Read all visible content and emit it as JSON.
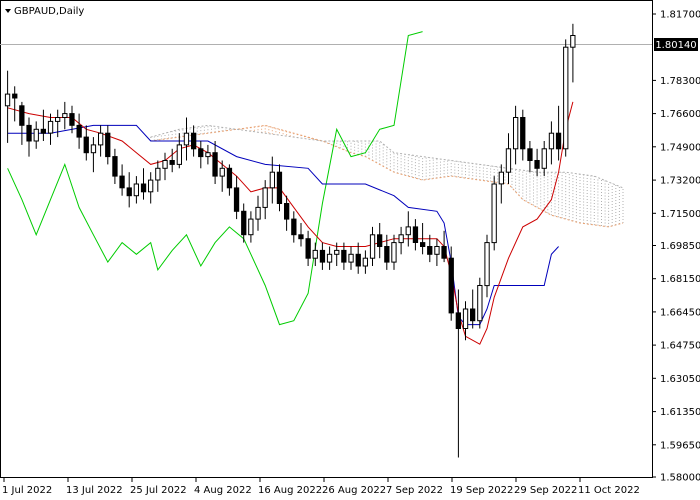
{
  "chart_title": "GBPAUD,Daily",
  "current_price_label": "1.80140",
  "colors": {
    "background": "#ffffff",
    "candle_stroke": "#000000",
    "bull_fill": "#ffffff",
    "bear_fill": "#000000",
    "tenkan": "#cc0000",
    "kijun": "#0000bb",
    "chikou": "#00cc00",
    "cloud": "#e8a070",
    "cloud_b": "#b0b0b0",
    "price_line": "#b0b0b0"
  },
  "chart_data": {
    "type": "candlestick",
    "title": "GBPAUD,Daily",
    "indicator": "Ichimoku",
    "ylim": [
      1.58,
      1.817
    ],
    "y_ticks": [
      "1.81700",
      "1.80140",
      "1.78300",
      "1.76600",
      "1.74900",
      "1.73200",
      "1.71500",
      "1.69850",
      "1.68150",
      "1.66450",
      "1.64750",
      "1.63050",
      "1.61350",
      "1.59650",
      "1.58000"
    ],
    "x_ticks": [
      "1 Jul 2022",
      "13 Jul 2022",
      "25 Jul 2022",
      "4 Aug 2022",
      "16 Aug 2022",
      "26 Aug 2022",
      "7 Sep 2022",
      "19 Sep 2022",
      "29 Sep 2022",
      "11 Oct 2022"
    ],
    "candles": [
      [
        1.77,
        1.788,
        1.751,
        1.776
      ],
      [
        1.776,
        1.78,
        1.762,
        1.774
      ],
      [
        1.77,
        1.772,
        1.75,
        1.76
      ],
      [
        1.76,
        1.764,
        1.744,
        1.752
      ],
      [
        1.752,
        1.762,
        1.748,
        1.758
      ],
      [
        1.758,
        1.768,
        1.752,
        1.756
      ],
      [
        1.756,
        1.766,
        1.75,
        1.762
      ],
      [
        1.762,
        1.768,
        1.754,
        1.764
      ],
      [
        1.764,
        1.772,
        1.758,
        1.766
      ],
      [
        1.766,
        1.77,
        1.756,
        1.76
      ],
      [
        1.76,
        1.766,
        1.748,
        1.754
      ],
      [
        1.754,
        1.76,
        1.742,
        1.746
      ],
      [
        1.746,
        1.754,
        1.736,
        1.75
      ],
      [
        1.75,
        1.76,
        1.744,
        1.756
      ],
      [
        1.756,
        1.76,
        1.74,
        1.744
      ],
      [
        1.744,
        1.748,
        1.73,
        1.734
      ],
      [
        1.734,
        1.74,
        1.724,
        1.728
      ],
      [
        1.728,
        1.736,
        1.718,
        1.724
      ],
      [
        1.724,
        1.734,
        1.72,
        1.73
      ],
      [
        1.73,
        1.738,
        1.722,
        1.726
      ],
      [
        1.726,
        1.736,
        1.72,
        1.732
      ],
      [
        1.732,
        1.742,
        1.726,
        1.738
      ],
      [
        1.738,
        1.746,
        1.732,
        1.742
      ],
      [
        1.742,
        1.748,
        1.736,
        1.74
      ],
      [
        1.74,
        1.756,
        1.738,
        1.75
      ],
      [
        1.75,
        1.764,
        1.742,
        1.756
      ],
      [
        1.756,
        1.76,
        1.744,
        1.748
      ],
      [
        1.748,
        1.752,
        1.738,
        1.744
      ],
      [
        1.744,
        1.75,
        1.74,
        1.746
      ],
      [
        1.746,
        1.752,
        1.73,
        1.734
      ],
      [
        1.734,
        1.742,
        1.726,
        1.738
      ],
      [
        1.738,
        1.74,
        1.724,
        1.728
      ],
      [
        1.728,
        1.734,
        1.712,
        1.716
      ],
      [
        1.716,
        1.72,
        1.7,
        1.704
      ],
      [
        1.704,
        1.716,
        1.7,
        1.712
      ],
      [
        1.712,
        1.724,
        1.706,
        1.718
      ],
      [
        1.718,
        1.732,
        1.712,
        1.728
      ],
      [
        1.728,
        1.744,
        1.72,
        1.736
      ],
      [
        1.736,
        1.74,
        1.716,
        1.72
      ],
      [
        1.72,
        1.724,
        1.706,
        1.712
      ],
      [
        1.712,
        1.716,
        1.7,
        1.704
      ],
      [
        1.704,
        1.71,
        1.698,
        1.702
      ],
      [
        1.702,
        1.706,
        1.688,
        1.692
      ],
      [
        1.692,
        1.7,
        1.688,
        1.696
      ],
      [
        1.696,
        1.7,
        1.686,
        1.69
      ],
      [
        1.69,
        1.698,
        1.686,
        1.694
      ],
      [
        1.694,
        1.7,
        1.688,
        1.696
      ],
      [
        1.696,
        1.7,
        1.686,
        1.69
      ],
      [
        1.69,
        1.698,
        1.686,
        1.694
      ],
      [
        1.694,
        1.7,
        1.684,
        1.688
      ],
      [
        1.688,
        1.696,
        1.684,
        1.692
      ],
      [
        1.692,
        1.708,
        1.688,
        1.704
      ],
      [
        1.704,
        1.71,
        1.692,
        1.698
      ],
      [
        1.698,
        1.704,
        1.686,
        1.69
      ],
      [
        1.69,
        1.704,
        1.686,
        1.7
      ],
      [
        1.7,
        1.708,
        1.694,
        1.704
      ],
      [
        1.704,
        1.716,
        1.698,
        1.708
      ],
      [
        1.708,
        1.712,
        1.696,
        1.7
      ],
      [
        1.7,
        1.71,
        1.694,
        1.698
      ],
      [
        1.698,
        1.704,
        1.69,
        1.694
      ],
      [
        1.694,
        1.702,
        1.688,
        1.698
      ],
      [
        1.698,
        1.706,
        1.69,
        1.692
      ],
      [
        1.692,
        1.698,
        1.66,
        1.664
      ],
      [
        1.664,
        1.676,
        1.59,
        1.656
      ],
      [
        1.656,
        1.67,
        1.65,
        1.666
      ],
      [
        1.666,
        1.676,
        1.656,
        1.66
      ],
      [
        1.66,
        1.682,
        1.656,
        1.678
      ],
      [
        1.678,
        1.704,
        1.672,
        1.7
      ],
      [
        1.7,
        1.734,
        1.696,
        1.73
      ],
      [
        1.73,
        1.74,
        1.72,
        1.736
      ],
      [
        1.736,
        1.756,
        1.73,
        1.748
      ],
      [
        1.748,
        1.77,
        1.74,
        1.764
      ],
      [
        1.764,
        1.768,
        1.742,
        1.748
      ],
      [
        1.748,
        1.752,
        1.736,
        1.742
      ],
      [
        1.742,
        1.748,
        1.734,
        1.738
      ],
      [
        1.738,
        1.752,
        1.734,
        1.748
      ],
      [
        1.748,
        1.762,
        1.74,
        1.756
      ],
      [
        1.756,
        1.77,
        1.742,
        1.748
      ],
      [
        1.748,
        1.804,
        1.744,
        1.8
      ],
      [
        1.8,
        1.812,
        1.782,
        1.806
      ]
    ],
    "tenkan": [
      [
        0,
        1.769
      ],
      [
        3,
        1.766
      ],
      [
        6,
        1.764
      ],
      [
        9,
        1.764
      ],
      [
        11,
        1.758
      ],
      [
        13,
        1.756
      ],
      [
        16,
        1.752
      ],
      [
        18,
        1.746
      ],
      [
        20,
        1.74
      ],
      [
        22,
        1.742
      ],
      [
        24,
        1.748
      ],
      [
        26,
        1.75
      ],
      [
        28,
        1.746
      ],
      [
        30,
        1.74
      ],
      [
        32,
        1.734
      ],
      [
        34,
        1.726
      ],
      [
        36,
        1.728
      ],
      [
        38,
        1.728
      ],
      [
        40,
        1.718
      ],
      [
        42,
        1.708
      ],
      [
        44,
        1.7
      ],
      [
        46,
        1.698
      ],
      [
        48,
        1.698
      ],
      [
        50,
        1.698
      ],
      [
        52,
        1.7
      ],
      [
        54,
        1.702
      ],
      [
        56,
        1.702
      ],
      [
        58,
        1.702
      ],
      [
        60,
        1.702
      ],
      [
        61,
        1.698
      ],
      [
        62,
        1.684
      ],
      [
        63,
        1.664
      ],
      [
        64,
        1.652
      ],
      [
        66,
        1.648
      ],
      [
        67,
        1.656
      ],
      [
        68,
        1.672
      ],
      [
        70,
        1.692
      ],
      [
        72,
        1.708
      ],
      [
        74,
        1.712
      ],
      [
        76,
        1.722
      ],
      [
        77,
        1.736
      ],
      [
        78,
        1.758
      ],
      [
        79,
        1.772
      ]
    ],
    "kijun": [
      [
        0,
        1.756
      ],
      [
        6,
        1.756
      ],
      [
        12,
        1.76
      ],
      [
        18,
        1.76
      ],
      [
        20,
        1.752
      ],
      [
        28,
        1.752
      ],
      [
        32,
        1.744
      ],
      [
        36,
        1.74
      ],
      [
        42,
        1.738
      ],
      [
        44,
        1.73
      ],
      [
        50,
        1.73
      ],
      [
        54,
        1.724
      ],
      [
        56,
        1.718
      ],
      [
        60,
        1.716
      ],
      [
        61,
        1.71
      ],
      [
        62,
        1.69
      ],
      [
        63,
        1.662
      ],
      [
        64,
        1.658
      ],
      [
        66,
        1.658
      ],
      [
        67,
        1.666
      ],
      [
        68,
        1.678
      ],
      [
        70,
        1.678
      ],
      [
        75,
        1.678
      ],
      [
        76,
        1.694
      ],
      [
        77,
        1.698
      ]
    ],
    "chikou": [
      [
        0,
        1.738
      ],
      [
        2,
        1.722
      ],
      [
        4,
        1.704
      ],
      [
        6,
        1.722
      ],
      [
        8,
        1.74
      ],
      [
        10,
        1.718
      ],
      [
        12,
        1.704
      ],
      [
        14,
        1.69
      ],
      [
        16,
        1.7
      ],
      [
        18,
        1.694
      ],
      [
        20,
        1.7
      ],
      [
        21,
        1.686
      ],
      [
        23,
        1.696
      ],
      [
        25,
        1.704
      ],
      [
        27,
        1.688
      ],
      [
        29,
        1.7
      ],
      [
        31,
        1.708
      ],
      [
        33,
        1.702
      ],
      [
        34,
        1.694
      ],
      [
        36,
        1.678
      ],
      [
        38,
        1.658
      ],
      [
        40,
        1.66
      ],
      [
        42,
        1.674
      ],
      [
        44,
        1.72
      ],
      [
        46,
        1.758
      ],
      [
        48,
        1.744
      ],
      [
        50,
        1.746
      ],
      [
        52,
        1.758
      ],
      [
        54,
        1.76
      ],
      [
        56,
        1.806
      ],
      [
        58,
        1.808
      ]
    ],
    "span_a": [
      [
        20,
        1.752
      ],
      [
        24,
        1.754
      ],
      [
        28,
        1.756
      ],
      [
        32,
        1.758
      ],
      [
        36,
        1.76
      ],
      [
        40,
        1.756
      ],
      [
        44,
        1.752
      ],
      [
        48,
        1.746
      ],
      [
        50,
        1.744
      ],
      [
        54,
        1.736
      ],
      [
        58,
        1.732
      ],
      [
        62,
        1.734
      ],
      [
        66,
        1.732
      ],
      [
        70,
        1.73
      ],
      [
        72,
        1.722
      ],
      [
        76,
        1.714
      ],
      [
        80,
        1.71
      ],
      [
        84,
        1.708
      ],
      [
        86,
        1.71
      ]
    ],
    "span_b": [
      [
        20,
        1.754
      ],
      [
        24,
        1.758
      ],
      [
        28,
        1.76
      ],
      [
        32,
        1.758
      ],
      [
        36,
        1.756
      ],
      [
        40,
        1.754
      ],
      [
        44,
        1.752
      ],
      [
        48,
        1.752
      ],
      [
        52,
        1.752
      ],
      [
        54,
        1.746
      ],
      [
        58,
        1.744
      ],
      [
        62,
        1.742
      ],
      [
        66,
        1.74
      ],
      [
        70,
        1.738
      ],
      [
        74,
        1.736
      ],
      [
        78,
        1.736
      ],
      [
        82,
        1.734
      ],
      [
        86,
        1.728
      ]
    ]
  }
}
